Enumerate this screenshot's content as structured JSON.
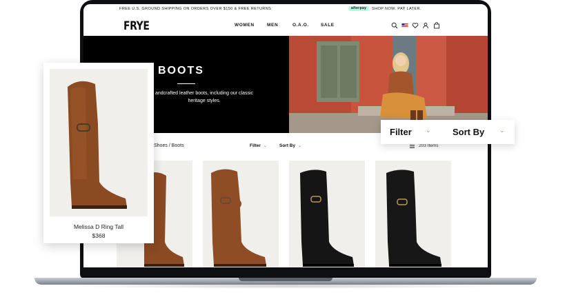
{
  "announcement": {
    "shipping": "FREE U.S. GROUND SHIPPING ON ORDERS OVER $150 & FREE RETURNS",
    "afterpay": "afterpay",
    "shop_now": "SHOP NOW. PAY LATER."
  },
  "header": {
    "logo": "FRYE",
    "nav": [
      "WOMEN",
      "MEN",
      "O.A.O.",
      "SALE"
    ],
    "icons": [
      "search-icon",
      "us-flag-icon",
      "heart-icon",
      "user-icon",
      "bag-icon"
    ]
  },
  "hero": {
    "title": "BOOTS",
    "description": "andcrafted leather boots, including our classic heritage styles."
  },
  "toolbar": {
    "breadcrumb": "Shoes / Boots",
    "filter": "Filter",
    "sort_by": "Sort By",
    "items_count": "203 Items"
  },
  "products": [
    {
      "color": "brown"
    },
    {
      "color": "brown"
    },
    {
      "color": "black"
    },
    {
      "color": "black"
    }
  ],
  "featured_card": {
    "name": "Melissa D Ring Tall",
    "price": "$368"
  },
  "filter_card": {
    "filter": "Filter",
    "sort_by": "Sort By"
  },
  "colors": {
    "brown_leather": "#8a4a22",
    "black_leather": "#151515",
    "afterpay_mint": "#b2fce4",
    "hero_wall": "#c8543e",
    "chevron_gold": "#b98a3d"
  }
}
